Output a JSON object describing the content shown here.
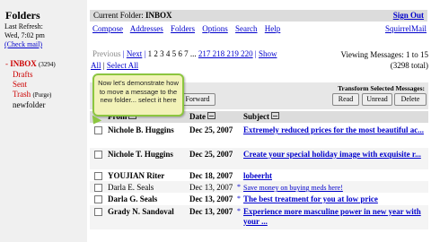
{
  "left": {
    "title": "Folders",
    "last_refresh_label": "Last Refresh:",
    "last_refresh_time": "Wed, 7:02 pm",
    "check_mail": "(Check mail)",
    "folders": [
      {
        "arrow": "-",
        "name": "INBOX",
        "count": "(3294)"
      },
      {
        "name": "Drafts"
      },
      {
        "name": "Sent"
      },
      {
        "name": "Trash",
        "extra": "(Purge)"
      },
      {
        "name": "newfolder"
      }
    ]
  },
  "header": {
    "current_folder_label": "Current Folder:",
    "current_folder": "INBOX",
    "sign_out": "Sign Out",
    "nav": [
      "Compose",
      "Addresses",
      "Folders",
      "Options",
      "Search",
      "Help"
    ],
    "brand_link": "SquirrelMail"
  },
  "pager": {
    "previous": "Previous",
    "next": "Next",
    "pages": "1 2 3 4 5 6 7",
    "dots": "...",
    "later_pages": "217 218 219 220",
    "show": "Show",
    "all": "All",
    "select_all": "Select All",
    "viewing": "Viewing Messages: 1 to 15",
    "total": "(3298 total)"
  },
  "actions": {
    "transform_label": "Transform Selected Messages:",
    "read": "Read",
    "unread": "Unread",
    "delete": "Delete",
    "forward": "Forward"
  },
  "columns": {
    "from": "From",
    "date": "Date",
    "subject": "Subject"
  },
  "tooltip": "Now let's demonstrate how to move a message to the new folder... select it here",
  "messages": [
    {
      "from": "Nichole B. Huggins",
      "date": "Dec 25, 2007",
      "subject": "Extremely reduced prices for the most beautiful ac..."
    },
    {
      "from": "Nichole T. Huggins",
      "date": "Dec 25, 2007",
      "subject": "Create your special holiday image with exquisite r..."
    },
    {
      "from": "YOUJIAN Riter",
      "date": "Dec 18, 2007",
      "subject": "lobeerht"
    },
    {
      "from": "Darla E. Seals",
      "date": "Dec 13, 2007",
      "star": "*",
      "subject": "Save money on buying meds here!"
    },
    {
      "from": "Darla G. Seals",
      "date": "Dec 13, 2007",
      "star": "*",
      "subject": "The best treatment for you at low price"
    },
    {
      "from": "Grady N. Sandoval",
      "date": "Dec 13, 2007",
      "star": "*",
      "subject": "Experience more masculine power in new year with your ..."
    }
  ]
}
